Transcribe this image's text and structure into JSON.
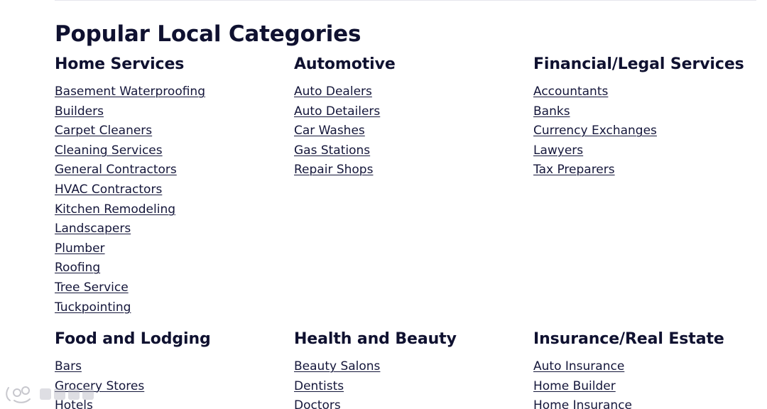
{
  "page": {
    "title": "Popular Local Categories"
  },
  "groups": [
    {
      "heading": "Home Services",
      "links": [
        "Basement Waterproofing",
        "Builders",
        "Carpet Cleaners",
        "Cleaning Services",
        "General Contractors",
        "HVAC Contractors",
        "Kitchen Remodeling",
        "Landscapers",
        "Plumber",
        "Roofing",
        "Tree Service",
        "Tuckpointing"
      ]
    },
    {
      "heading": "Automotive",
      "links": [
        "Auto Dealers",
        "Auto Detailers",
        "Car Washes",
        "Gas Stations",
        "Repair Shops"
      ]
    },
    {
      "heading": "Financial/Legal Services",
      "links": [
        "Accountants",
        "Banks",
        "Currency Exchanges",
        "Lawyers",
        "Tax Preparers"
      ]
    },
    {
      "heading": "Food and Lodging",
      "links": [
        "Bars",
        "Grocery Stores",
        "Hotels"
      ]
    },
    {
      "heading": "Health and Beauty",
      "links": [
        "Beauty Salons",
        "Dentists",
        "Doctors"
      ]
    },
    {
      "heading": "Insurance/Real Estate",
      "links": [
        "Auto Insurance",
        "Home Builder",
        "Home Insurance"
      ]
    }
  ],
  "colors": {
    "heading": "#0f1130",
    "link": "#14163a",
    "background": "#ffffff"
  }
}
